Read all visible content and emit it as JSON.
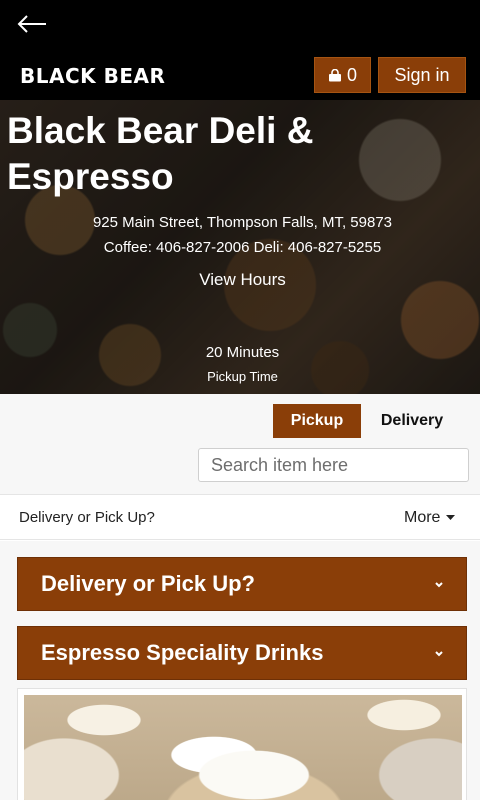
{
  "header": {
    "brand": "BLACK BEAR",
    "cart_count": "0",
    "signin_label": "Sign in"
  },
  "hero": {
    "title": "Black Bear Deli & Espresso",
    "address": "925 Main Street, Thompson Falls, MT, 59873",
    "phones": "Coffee: 406-827-2006 Deli: 406-827-5255",
    "hours_link": "View Hours",
    "pickup_time": "20 Minutes",
    "pickup_label": "Pickup Time"
  },
  "order_mode": {
    "tabs": [
      {
        "label": "Pickup",
        "active": true
      },
      {
        "label": "Delivery",
        "active": false
      }
    ],
    "search_placeholder": "Search item here"
  },
  "category_nav": {
    "current": "Delivery or Pick Up?",
    "more_label": "More"
  },
  "categories": [
    {
      "label": "Delivery or Pick Up?"
    },
    {
      "label": "Espresso Speciality Drinks"
    }
  ],
  "colors": {
    "accent": "#8a3e08",
    "topbar": "#000000",
    "page_bg": "#f7f7f7"
  },
  "icons": {
    "back": "arrow-left",
    "cart": "shopping-bag",
    "more": "caret-down",
    "category": "chevron-down"
  }
}
